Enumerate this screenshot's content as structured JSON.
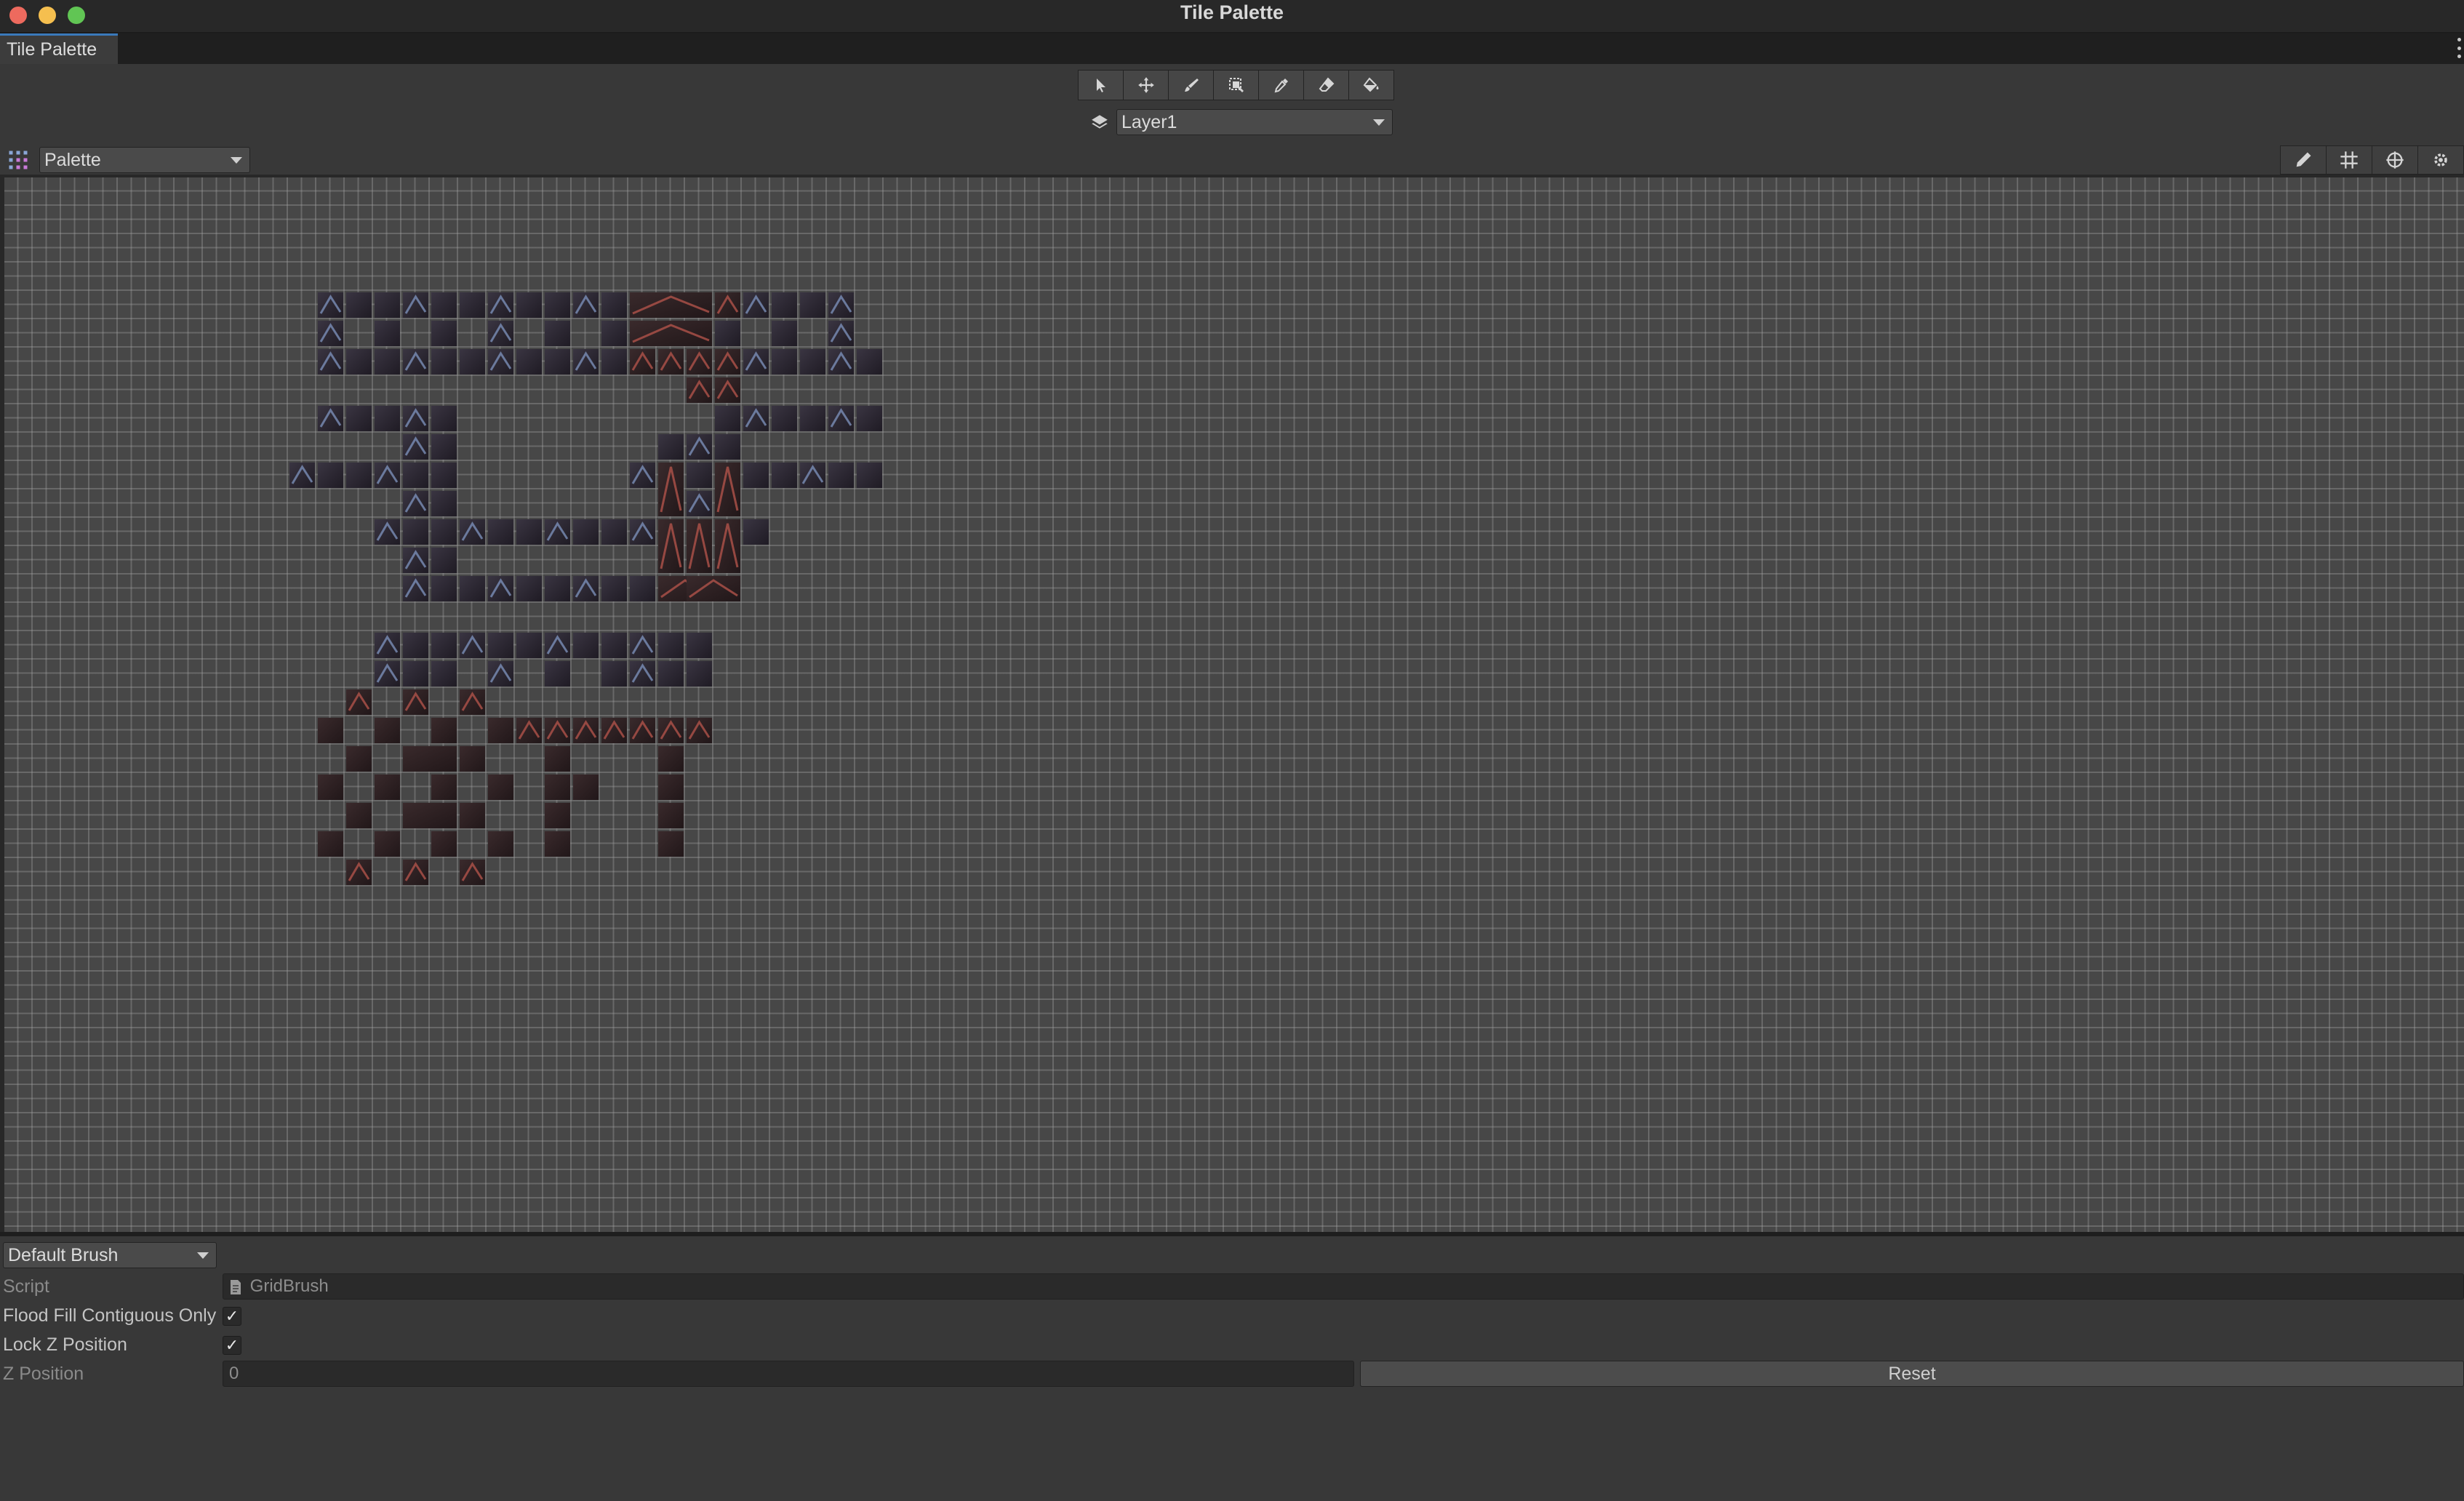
{
  "window": {
    "title": "Tile Palette"
  },
  "tabs": [
    {
      "label": "Tile Palette",
      "active": true
    }
  ],
  "toolbar": {
    "tools": [
      {
        "name": "select",
        "icon": "arrow-cursor-icon"
      },
      {
        "name": "move",
        "icon": "move-arrows-icon"
      },
      {
        "name": "paint",
        "icon": "brush-icon"
      },
      {
        "name": "box-fill",
        "icon": "box-fill-icon"
      },
      {
        "name": "pick",
        "icon": "eyedropper-icon"
      },
      {
        "name": "erase",
        "icon": "eraser-icon"
      },
      {
        "name": "fill",
        "icon": "paint-bucket-icon"
      }
    ],
    "active_target": "Layer1"
  },
  "palette": {
    "selected": "Palette",
    "edit_buttons": [
      "edit-pencil-icon",
      "grid-icon",
      "gizmo-icon",
      "settings-gear-icon"
    ]
  },
  "brush": {
    "selected": "Default Brush",
    "properties": {
      "script_label": "Script",
      "script_value": "GridBrush",
      "flood_fill_label": "Flood Fill Contiguous Only",
      "flood_fill_checked": true,
      "lock_z_label": "Lock Z Position",
      "lock_z_checked": true,
      "z_position_label": "Z Position",
      "z_position_value": "0",
      "reset_label": "Reset"
    }
  },
  "colors": {
    "accent": "#3a79bb",
    "grid_bg": "#474747",
    "ice_tile": "#2a2530",
    "ice_highlight": "#7a8fb8",
    "rust_tile": "#2b1f22",
    "rust_highlight": "#b0524a"
  }
}
